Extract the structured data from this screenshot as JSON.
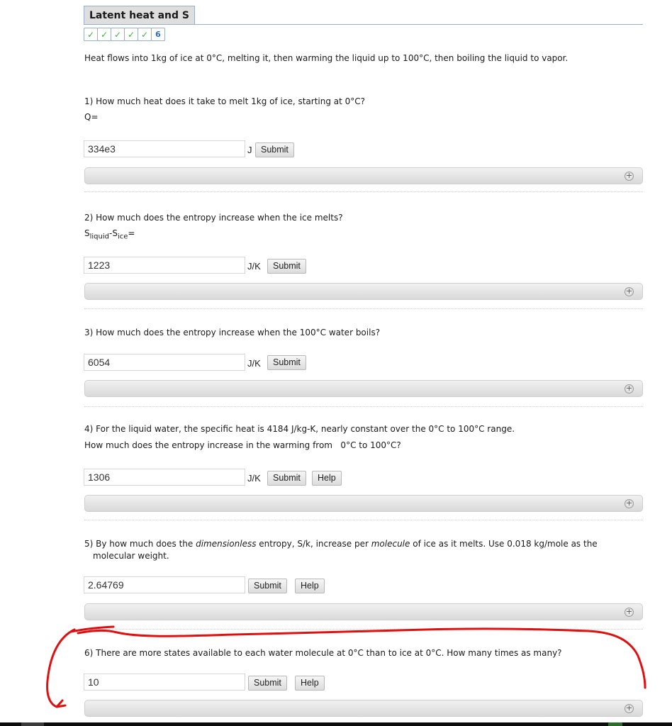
{
  "header": {
    "title": "Latent heat and S",
    "progress": [
      {
        "state": "correct",
        "icon": "check-icon",
        "label": "✓"
      },
      {
        "state": "correct",
        "icon": "check-icon",
        "label": "✓"
      },
      {
        "state": "correct",
        "icon": "check-icon",
        "label": "✓"
      },
      {
        "state": "correct",
        "icon": "check-icon",
        "label": "✓"
      },
      {
        "state": "correct",
        "icon": "check-icon",
        "label": "✓"
      },
      {
        "state": "current",
        "label": "6"
      }
    ]
  },
  "intro": "Heat flows into 1kg of ice at 0°C, melting it, then warming the liquid up to 100°C, then boiling the liquid to vapor.",
  "questions": [
    {
      "text": "1) How much heat does it take to melt 1kg of ice, starting at 0°C?",
      "prefix": "Q=",
      "value": "334e3",
      "unit": "J",
      "submit_label": "Submit"
    },
    {
      "text": "2) How much does the entropy increase when the ice melts?",
      "prefix_parts": {
        "s1": "S",
        "sub1": "liquid",
        "minus": "-",
        "s2": "S",
        "sub2": "ice",
        "eq": "="
      },
      "value": "1223",
      "unit": "J/K",
      "submit_label": "Submit"
    },
    {
      "text": "3) How much does the entropy increase when the 100°C water boils?",
      "value": "6054",
      "unit": "J/K",
      "submit_label": "Submit"
    },
    {
      "text": "4) For the liquid water, the specific heat is 4184 J/kg-K, nearly constant over the 0°C to 100°C range.",
      "text2": "How much does the entropy increase in the warming from   0°C to 100°C?",
      "value": "1306",
      "unit": "J/K",
      "submit_label": "Submit",
      "help_label": "Help"
    },
    {
      "text_a": "5) By how much does the ",
      "text_em1": "dimensionless",
      "text_b": " entropy, S/k, increase per ",
      "text_em2": "molecule",
      "text_c": " of ice as it melts. Use 0.018 kg/mole as the",
      "text_line2": "molecular weight.",
      "value": "2.64769",
      "submit_label": "Submit",
      "help_label": "Help"
    },
    {
      "text": "6) There are more states available to each water molecule at 0°C than to ice at 0°C. How many times as many?",
      "value": "10",
      "submit_label": "Submit",
      "help_label": "Help"
    }
  ],
  "hint_expand_symbol": "+",
  "annotation_color": "#e01010"
}
